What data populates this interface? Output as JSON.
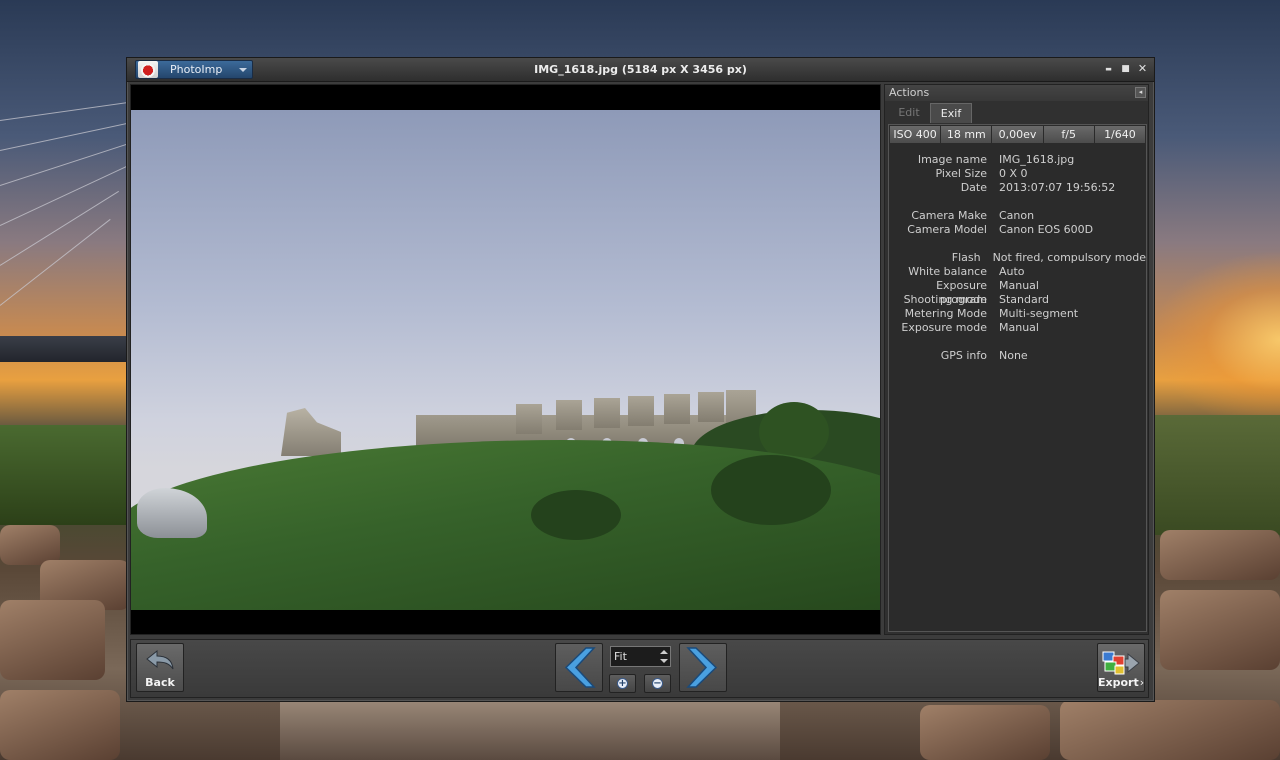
{
  "window": {
    "title": "IMG_1618.jpg (5184 px X 3456 px)",
    "app_menu_label": "PhotoImp"
  },
  "window_controls": {
    "minimize": "▬",
    "maximize": "■",
    "close": "✕"
  },
  "actions_panel": {
    "title": "Actions",
    "pin_symbol": "◂",
    "tabs": [
      {
        "label": "Edit",
        "active": false
      },
      {
        "label": "Exif",
        "active": true
      }
    ],
    "summary": [
      "ISO 400",
      "18 mm",
      "0,00ev",
      "f/5",
      "1/640"
    ],
    "exif_rows": [
      {
        "key": "Image name",
        "value": "IMG_1618.jpg"
      },
      {
        "key": "Pixel Size",
        "value": "0 X 0"
      },
      {
        "key": "Date",
        "value": "2013:07:07 19:56:52"
      },
      {
        "key": "",
        "value": ""
      },
      {
        "key": "Camera Make",
        "value": "Canon"
      },
      {
        "key": "Camera Model",
        "value": "Canon EOS 600D"
      },
      {
        "key": "",
        "value": ""
      },
      {
        "key": "Flash",
        "value": "Not fired, compulsory mode"
      },
      {
        "key": "White balance",
        "value": "Auto"
      },
      {
        "key": "Exposure program",
        "value": "Manual"
      },
      {
        "key": "Shooting mode",
        "value": "Standard"
      },
      {
        "key": "Metering Mode",
        "value": "Multi-segment"
      },
      {
        "key": "Exposure mode",
        "value": "Manual"
      },
      {
        "key": "",
        "value": ""
      },
      {
        "key": "GPS info",
        "value": "None"
      }
    ]
  },
  "bottom_bar": {
    "back_label": "Back",
    "export_label": "Export",
    "export_caret": "›",
    "zoom_value": "Fit",
    "zoom_in_symbol": "+",
    "zoom_out_symbol": "−"
  },
  "icons": {
    "back": "back-arrow-icon",
    "export": "export-icon",
    "previous": "chevron-left-icon",
    "next": "chevron-right-icon",
    "zoom_in": "zoom-in-icon",
    "zoom_out": "zoom-out-icon"
  },
  "colors": {
    "accent_blue": "#3c6a9a",
    "nav_arrow": "#4aa0e0",
    "panel_bg": "#303030"
  }
}
